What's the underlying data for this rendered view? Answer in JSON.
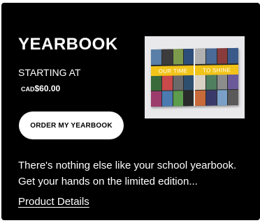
{
  "card": {
    "title": "YEARBOOK",
    "starting_label": "STARTING AT",
    "price_currency": "CAD",
    "price_amount": "$60.00",
    "order_button_label": "ORDER MY YEARBOOK",
    "description": "There's nothing else like your school yearbook. Get your hands on the limited edition...",
    "details_link_label": "Product Details",
    "image": {
      "banner_left": "OUR TIME",
      "banner_right": "TO SHINE"
    }
  },
  "colors": {
    "card_background": "#000000",
    "text": "#ffffff",
    "button_background": "#ffffff",
    "button_text": "#000000",
    "banner": "#f2c318",
    "image_background": "#e9e9eb"
  }
}
